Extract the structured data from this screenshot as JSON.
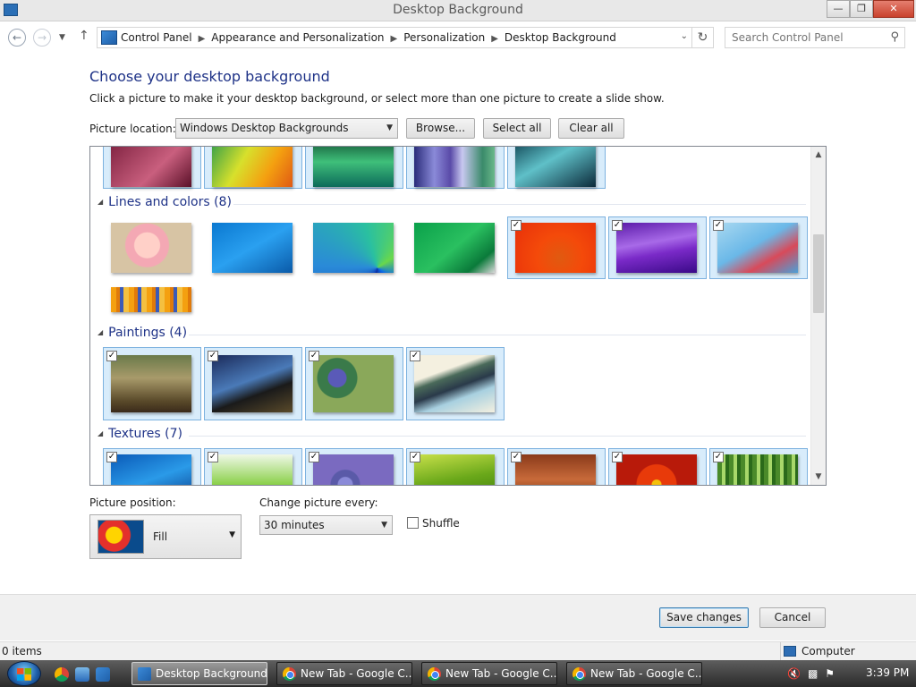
{
  "window": {
    "title": "Desktop Background"
  },
  "address": {
    "crumbs": [
      "Control Panel",
      "Appearance and Personalization",
      "Personalization",
      "Desktop Background"
    ],
    "search_placeholder": "Search Control Panel"
  },
  "main": {
    "heading": "Choose your desktop background",
    "subtext": "Click a picture to make it your desktop background, or select more than one picture to create a slide show.",
    "location_label": "Picture location:",
    "location_value": "Windows Desktop Backgrounds",
    "browse_label": "Browse...",
    "select_all_label": "Select all",
    "clear_all_label": "Clear all"
  },
  "gallery": {
    "groups": [
      {
        "label": "Lines and colors (8)"
      },
      {
        "label": "Paintings (4)"
      },
      {
        "label": "Textures (7)"
      }
    ]
  },
  "options": {
    "position_label": "Picture position:",
    "position_value": "Fill",
    "change_label": "Change picture every:",
    "change_value": "30 minutes",
    "shuffle_label": "Shuffle"
  },
  "footer": {
    "save_label": "Save changes",
    "cancel_label": "Cancel"
  },
  "status": {
    "items": "0 items",
    "location": "Computer"
  },
  "taskbar": {
    "tasks": [
      "Desktop Background",
      "New Tab - Google C...",
      "New Tab - Google C...",
      "New Tab - Google C..."
    ],
    "clock": "3:39 PM"
  },
  "colors": {
    "heading": "#1e3287",
    "selection": "#d8ecfb",
    "selection_border": "#7db2df"
  }
}
